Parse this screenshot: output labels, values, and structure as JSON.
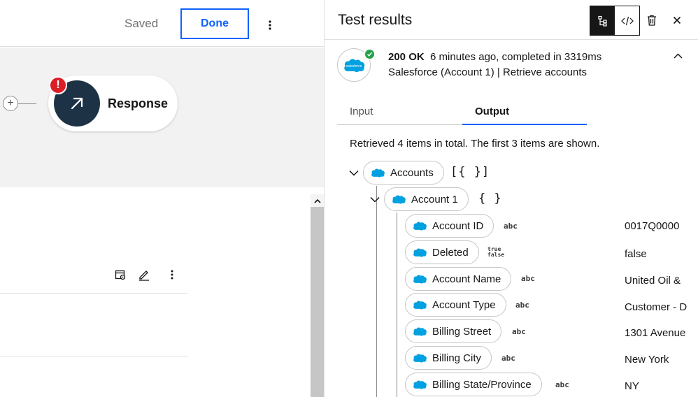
{
  "toolbar": {
    "saved_label": "Saved",
    "done_label": "Done"
  },
  "flow": {
    "node_label": "Response",
    "error_badge": "!"
  },
  "panel": {
    "title": "Test results",
    "status_code": "200 OK",
    "status_detail": "6 minutes ago, completed in 3319ms",
    "source": "Salesforce (Account 1) | Retrieve accounts",
    "tabs": [
      {
        "label": "Input",
        "active": false
      },
      {
        "label": "Output",
        "active": true
      }
    ],
    "summary": "Retrieved 4 items in total. The first 3 items are shown.",
    "tree": {
      "root": {
        "label": "Accounts",
        "type": "[{ }]"
      },
      "child": {
        "label": "Account 1",
        "type": "{ }"
      },
      "fields": [
        {
          "label": "Account ID",
          "type": "abc",
          "value": "0017Q0000"
        },
        {
          "label": "Deleted",
          "type_true": "true",
          "type_false": "false",
          "value": "false"
        },
        {
          "label": "Account Name",
          "type": "abc",
          "value": "United Oil &"
        },
        {
          "label": "Account Type",
          "type": "abc",
          "value": "Customer - D"
        },
        {
          "label": "Billing Street",
          "type": "abc",
          "value": "1301 Avenue"
        },
        {
          "label": "Billing City",
          "type": "abc",
          "value": "New York"
        },
        {
          "label": "Billing State/Province",
          "type": "abc",
          "value": "NY"
        }
      ]
    }
  },
  "icons": {
    "connector": "salesforce-icon",
    "accent_blue": "#0f62fe",
    "salesforce_blue": "#00a1e0",
    "success_green": "#24a148",
    "error_red": "#da1e28"
  }
}
